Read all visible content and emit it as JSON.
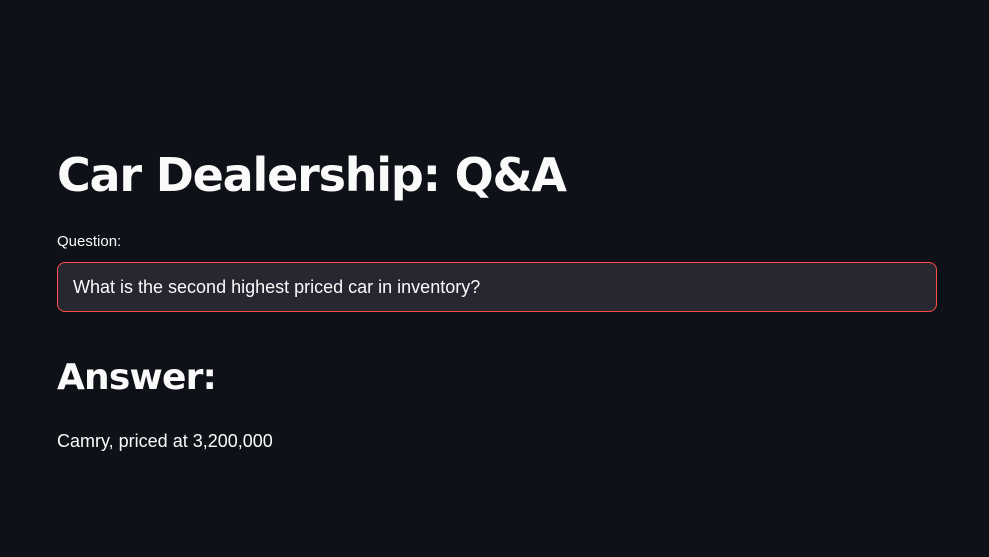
{
  "page": {
    "title": "Car Dealership: Q&A"
  },
  "question": {
    "label": "Question:",
    "value": "What is the second highest priced car in inventory?",
    "placeholder": ""
  },
  "answer": {
    "heading": "Answer:",
    "text": "Camry, priced at 3,200,000"
  },
  "colors": {
    "background": "#0e1117",
    "input_background": "#262730",
    "input_focus_border": "#ff4b4b",
    "text": "#fafafa"
  }
}
